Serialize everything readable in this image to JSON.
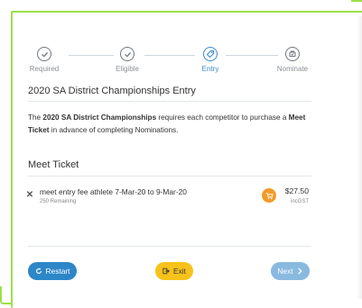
{
  "stepper": {
    "steps": [
      {
        "label": "Required",
        "icon": "check-icon",
        "state": "complete"
      },
      {
        "label": "Eligible",
        "icon": "check-icon",
        "state": "complete"
      },
      {
        "label": "Entry",
        "icon": "tag-icon",
        "state": "active"
      },
      {
        "label": "Nominate",
        "icon": "nominate-icon",
        "state": "upcoming"
      }
    ]
  },
  "entry": {
    "title": "2020 SA District Championships Entry",
    "intro_pre": "The ",
    "intro_event": "2020 SA District Championships",
    "intro_mid": " requires each competitor to purchase a ",
    "intro_ticket": "Meet Ticket",
    "intro_post": " in advance of completing Nominations."
  },
  "meet_ticket": {
    "heading": "Meet Ticket",
    "item": {
      "name": "meet entry fee athlete 7-Mar-20 to 9-Mar-20",
      "remaining": "250 Remaining",
      "price": "$27.50",
      "tax": "incGST"
    }
  },
  "footer": {
    "restart_label": "Restart",
    "exit_label": "Exit",
    "next_label": "Next"
  },
  "colors": {
    "frame": "#9be04a",
    "primary": "#2c86c8",
    "warning": "#f6c21b",
    "cart": "#f39a2a",
    "disabled": "#8ab9e0"
  }
}
